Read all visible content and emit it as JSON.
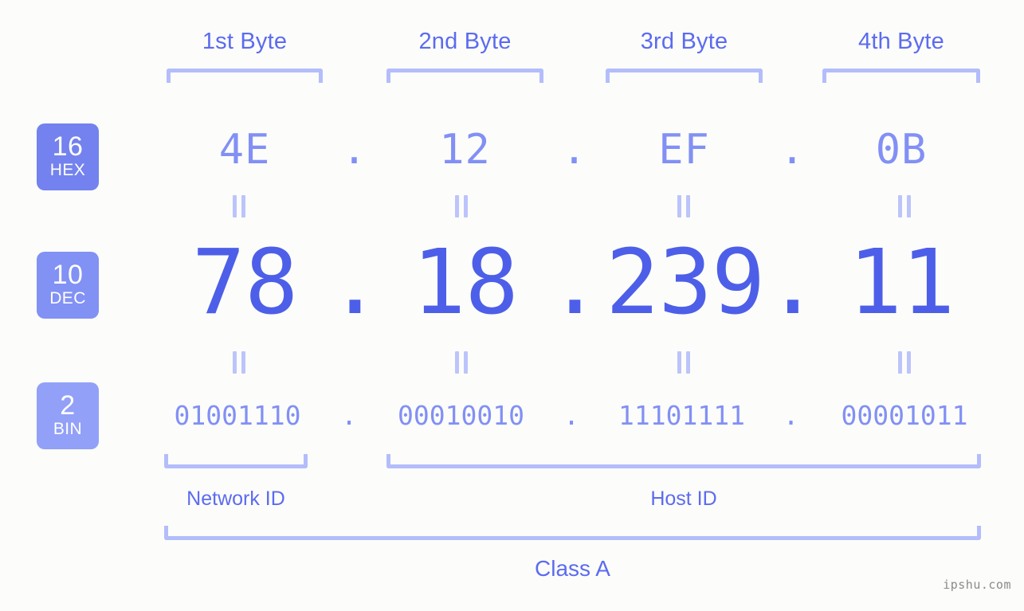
{
  "meta": {
    "watermark": "ipshu.com",
    "background_color": "#fcfdfa",
    "accent_strong": "#4d5fe8",
    "accent_mid": "#5c6bf0",
    "accent_light": "#8290f5",
    "accent_pale": "#b4bdfb"
  },
  "byte_headers": [
    {
      "label": "1st Byte"
    },
    {
      "label": "2nd Byte"
    },
    {
      "label": "3rd Byte"
    },
    {
      "label": "4th Byte"
    }
  ],
  "bases": [
    {
      "number": "16",
      "name": "HEX",
      "color": "#7382ee"
    },
    {
      "number": "10",
      "name": "DEC",
      "color": "#8291f4"
    },
    {
      "number": "2",
      "name": "BIN",
      "color": "#92a0f8"
    }
  ],
  "rows": {
    "hex": {
      "base_number": "16",
      "base_name": "HEX",
      "values": [
        "4E",
        "12",
        "EF",
        "0B"
      ],
      "separator": "."
    },
    "dec": {
      "base_number": "10",
      "base_name": "DEC",
      "values": [
        "78",
        "18",
        "239",
        "11"
      ],
      "separator": "."
    },
    "bin": {
      "base_number": "2",
      "base_name": "BIN",
      "values": [
        "01001110",
        "00010010",
        "11101111",
        "00001011"
      ],
      "separator": "."
    }
  },
  "equals_marker": "=",
  "partitions": [
    {
      "label": "Network ID"
    },
    {
      "label": "Host ID"
    }
  ],
  "class": {
    "label": "Class A"
  }
}
